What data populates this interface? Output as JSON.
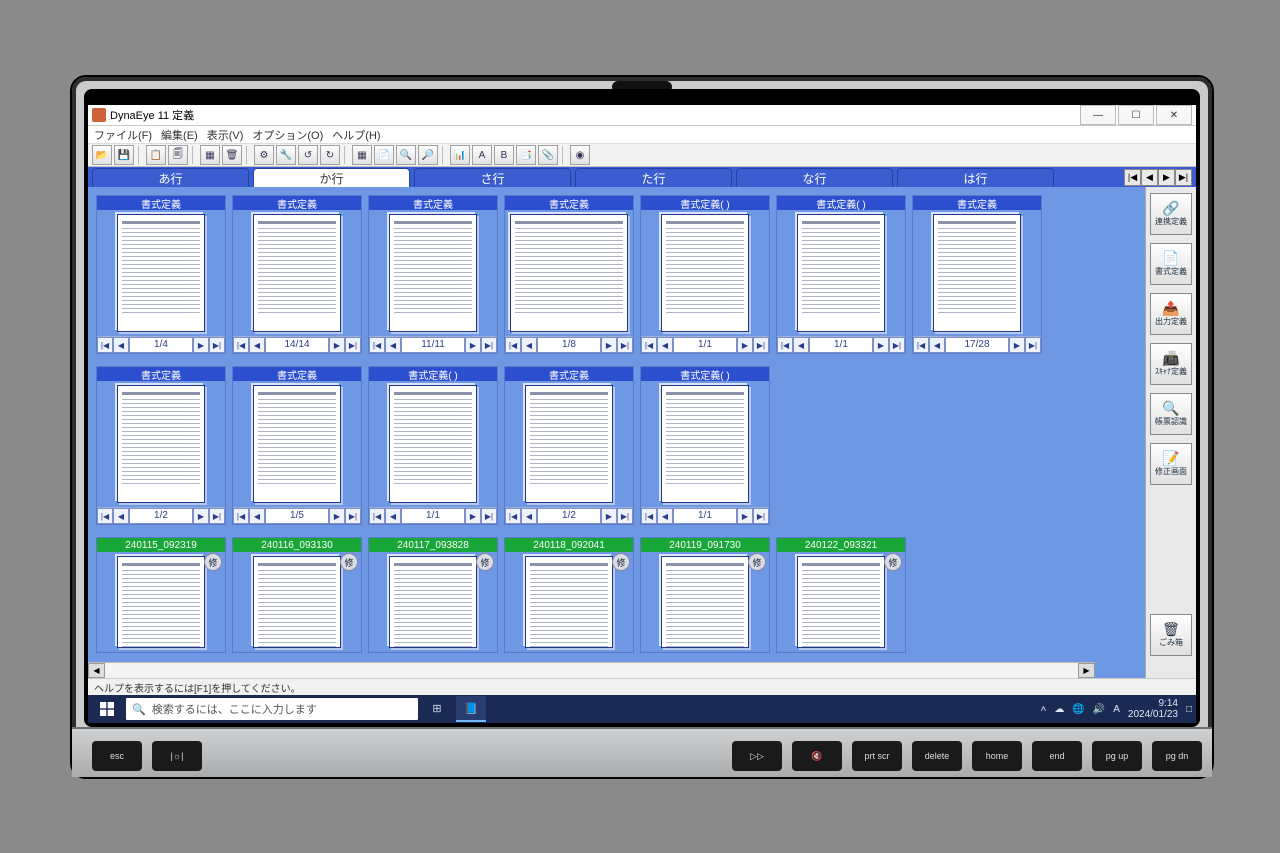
{
  "titlebar": {
    "title": "DynaEye 11 定義"
  },
  "menu": {
    "items": [
      "ファイル(F)",
      "編集(E)",
      "表示(V)",
      "オプション(O)",
      "ヘルプ(H)"
    ]
  },
  "toolbar_icons": [
    "📂",
    "💾",
    "|",
    "📋",
    "🗐",
    "|",
    "🔲",
    "🗑",
    "|",
    "⚙",
    "🔧",
    "↺",
    "↻",
    "|",
    "▦",
    "📄",
    "🔍",
    "🔎",
    "|",
    "📊",
    "🅰",
    "🅱",
    "📑",
    "📎",
    "|",
    "◉"
  ],
  "tabs": {
    "items": [
      "あ行",
      "か行",
      "さ行",
      "た行",
      "な行",
      "は行"
    ],
    "active": 1
  },
  "cards_row1": [
    {
      "title": "書式定義",
      "pager": "1/4"
    },
    {
      "title": "書式定義",
      "pager": "14/14"
    },
    {
      "title": "書式定義",
      "pager": "11/11"
    },
    {
      "title": "書式定義",
      "pager": "1/8",
      "wide": true
    },
    {
      "title": "書式定義(        )",
      "pager": "1/1"
    },
    {
      "title": "書式定義(           )",
      "pager": "1/1"
    },
    {
      "title": "書式定義",
      "pager": "17/28"
    }
  ],
  "cards_row2": [
    {
      "title": "書式定義",
      "pager": "1/2"
    },
    {
      "title": "書式定義",
      "pager": "1/5"
    },
    {
      "title": "書式定義(        )",
      "pager": "1/1"
    },
    {
      "title": "書式定義",
      "pager": "1/2"
    },
    {
      "title": "書式定義(        )",
      "pager": "1/1"
    }
  ],
  "cards_row3": [
    {
      "title": "240115_092319",
      "badge": "修"
    },
    {
      "title": "240116_093130",
      "badge": "修"
    },
    {
      "title": "240117_093828",
      "badge": "修"
    },
    {
      "title": "240118_092041",
      "badge": "修"
    },
    {
      "title": "240119_091730",
      "badge": "修"
    },
    {
      "title": "240122_093321",
      "badge": "修"
    }
  ],
  "side": {
    "buttons": [
      {
        "label": "連携定義",
        "icon": "🔗"
      },
      {
        "label": "書式定義",
        "icon": "📄"
      },
      {
        "label": "出力定義",
        "icon": "📤"
      },
      {
        "label": "ｽｷｬﾅ定義",
        "icon": "📠"
      },
      {
        "label": "帳票認識",
        "icon": "🔍"
      },
      {
        "label": "修正画面",
        "icon": "📝"
      }
    ],
    "trash_label": "ごみ箱"
  },
  "status": {
    "help": "ヘルプを表示するには[F1]を押してください。"
  },
  "taskbar": {
    "search_placeholder": "検索するには、ここに入力します",
    "ime_mode": "A",
    "time": "9:14",
    "date": "2024/01/23",
    "notif": "□"
  }
}
